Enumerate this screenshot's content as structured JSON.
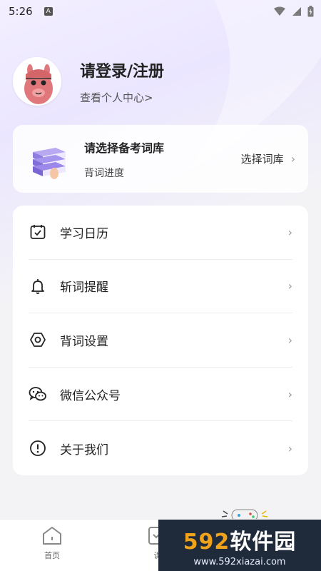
{
  "status_bar": {
    "time": "5:26",
    "badge": "A"
  },
  "profile": {
    "title": "请登录/注册",
    "link": "查看个人中心>"
  },
  "book_card": {
    "title": "请选择备考词库",
    "subtitle": "背词进度",
    "action": "选择词库"
  },
  "menu": [
    {
      "label": "学习日历",
      "icon": "calendar-icon"
    },
    {
      "label": "斩词提醒",
      "icon": "bell-icon"
    },
    {
      "label": "背词设置",
      "icon": "hexagon-settings-icon"
    },
    {
      "label": "微信公众号",
      "icon": "wechat-icon"
    },
    {
      "label": "关于我们",
      "icon": "info-icon"
    }
  ],
  "nav": {
    "home": "首页",
    "course": "课"
  },
  "watermark": {
    "brand_num": "592",
    "brand_text": "软件园",
    "url": "www.592xiazai.com"
  },
  "colors": {
    "accent": "#8a7cf0",
    "watermark_bg": "#1f2a3a",
    "watermark_orange": "#f0a21b"
  }
}
